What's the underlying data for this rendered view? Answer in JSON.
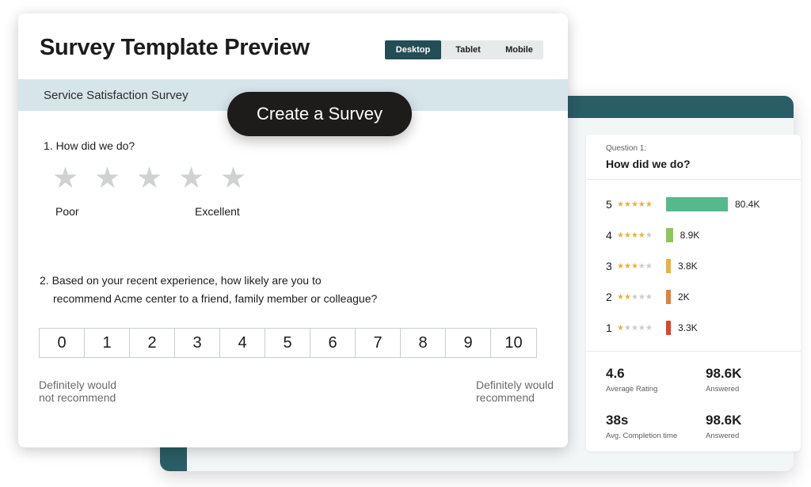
{
  "preview": {
    "title": "Survey Template Preview",
    "view_options": [
      "Desktop",
      "Tablet",
      "Mobile"
    ],
    "active_view": "Desktop",
    "survey_name": "Service Satisfaction Survey"
  },
  "create_button": {
    "label": "Create a Survey"
  },
  "question1": {
    "title": "1. How did we do?",
    "star_count": 5,
    "low_label": "Poor",
    "high_label": "Excellent"
  },
  "question2": {
    "line1": "2. Based on your recent experience, how likely are you to",
    "line2": "recommend Acme center to a friend, family member or colleague?",
    "scale": [
      "0",
      "1",
      "2",
      "3",
      "4",
      "5",
      "6",
      "7",
      "8",
      "9",
      "10"
    ],
    "low_label": "Definitely would not recommend",
    "high_label": "Definitely would recommend"
  },
  "results": {
    "question_number": "Question 1:",
    "question_title": "How did we do?",
    "ratings": [
      {
        "rating": "5",
        "stars": 5,
        "count": "80.4K",
        "value": 80.4,
        "color": "#55b98d"
      },
      {
        "rating": "4",
        "stars": 4,
        "count": "8.9K",
        "value": 8.9,
        "color": "#8cc65a"
      },
      {
        "rating": "3",
        "stars": 3,
        "count": "3.8K",
        "value": 3.8,
        "color": "#e9b43c"
      },
      {
        "rating": "2",
        "stars": 2,
        "count": "2K",
        "value": 2.0,
        "color": "#e3803a"
      },
      {
        "rating": "1",
        "stars": 1,
        "count": "3.3K",
        "value": 3.3,
        "color": "#d9462b"
      }
    ],
    "stats": {
      "average_rating": {
        "value": "4.6",
        "label": "Average Rating"
      },
      "answered_1": {
        "value": "98.6K",
        "label": "Answered"
      },
      "completion_time": {
        "value": "38s",
        "label": "Avg. Completion time"
      },
      "answered_2": {
        "value": "98.6K",
        "label": "Answered"
      }
    }
  },
  "colors": {
    "brand_dark": "#234e56",
    "band": "#d6e5ea",
    "star_gold": "#e8b03a",
    "pill": "#1e1b1b"
  },
  "icons": {
    "star": "star-icon"
  }
}
